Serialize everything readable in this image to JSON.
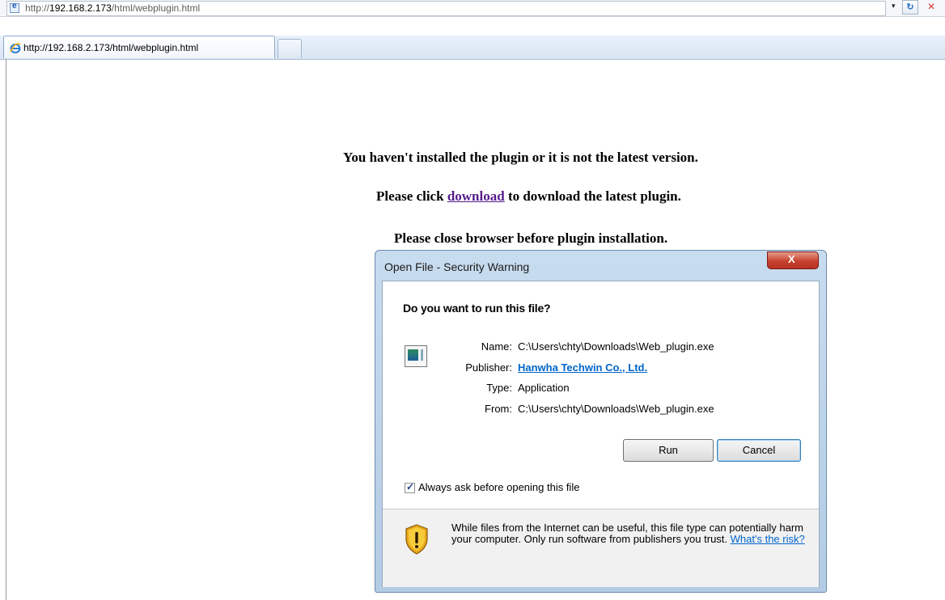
{
  "browser": {
    "address_prefix": "http://",
    "address_host": "192.168.2.173",
    "address_path": "/html/webplugin.html",
    "dropdown_glyph": "▾",
    "refresh_glyph": "↻",
    "stop_glyph": "×",
    "tab_title": "http://192.168.2.173/html/webplugin.html"
  },
  "page": {
    "line1": "You haven't installed the plugin or it is not the latest version.",
    "line2_before": "Please click ",
    "line2_link": "download",
    "line2_after": " to download the latest plugin.",
    "line3": "Please close browser before plugin installation."
  },
  "dialog": {
    "title": "Open File - Security Warning",
    "question": "Do you want to run this file?",
    "name_label": "Name:",
    "name_value": "C:\\Users\\chty\\Downloads\\Web_plugin.exe",
    "publisher_label": "Publisher:",
    "publisher_value": "Hanwha Techwin Co., Ltd.",
    "type_label": "Type:",
    "type_value": "Application",
    "from_label": "From:",
    "from_value": "C:\\Users\\chty\\Downloads\\Web_plugin.exe",
    "run_label": "Run",
    "cancel_label": "Cancel",
    "always_ask_label": "Always ask before opening this file",
    "always_ask_checked": true,
    "warning_text": "While files from the Internet can be useful, this file type can potentially harm your computer. Only run software from publishers you trust. ",
    "risk_link": "What's the risk?"
  }
}
